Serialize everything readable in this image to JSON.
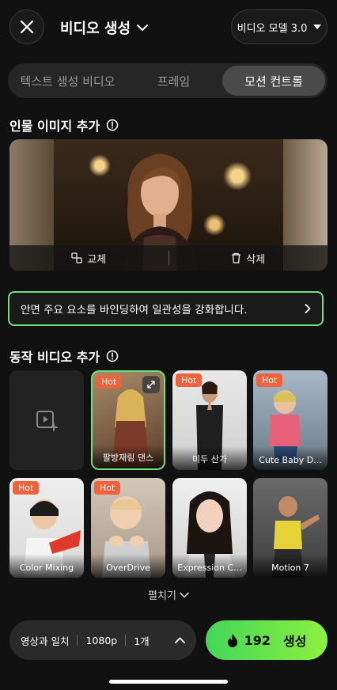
{
  "header": {
    "title": "비디오 생성",
    "model": "비디오 모델 3.0"
  },
  "tabs": [
    {
      "label": "텍스트 생성 비디오"
    },
    {
      "label": "프레임"
    },
    {
      "label": "모션 컨트롤",
      "active": true
    }
  ],
  "person_section": {
    "title": "인물 이미지 추가",
    "replace_label": "교체",
    "delete_label": "삭제"
  },
  "banner": {
    "text": "안면 주요 요소를 바인딩하여 일관성을 강화합니다."
  },
  "motion_section": {
    "title": "동작 비디오 추가",
    "items": [
      {
        "label": "",
        "hot": false,
        "add": true
      },
      {
        "label": "팔방재림 댄스",
        "hot": true,
        "selected": true
      },
      {
        "label": "미두 산가",
        "hot": true
      },
      {
        "label": "Cute Baby D...",
        "hot": true
      },
      {
        "label": "Color Mixing",
        "hot": true
      },
      {
        "label": "OverDrive",
        "hot": true
      },
      {
        "label": "Expression C...",
        "hot": false
      },
      {
        "label": "Motion 7",
        "hot": false
      }
    ],
    "hot_badge": "Hot",
    "expand_label": "펼치기"
  },
  "bottom": {
    "setting_1": "영상과 일치",
    "setting_2": "1080p",
    "setting_3": "1개",
    "credits": "192",
    "generate_label": "생성"
  },
  "colors": {
    "accent_green": "#6fe07a",
    "hot_badge": "#f0623c",
    "background": "#111111"
  }
}
